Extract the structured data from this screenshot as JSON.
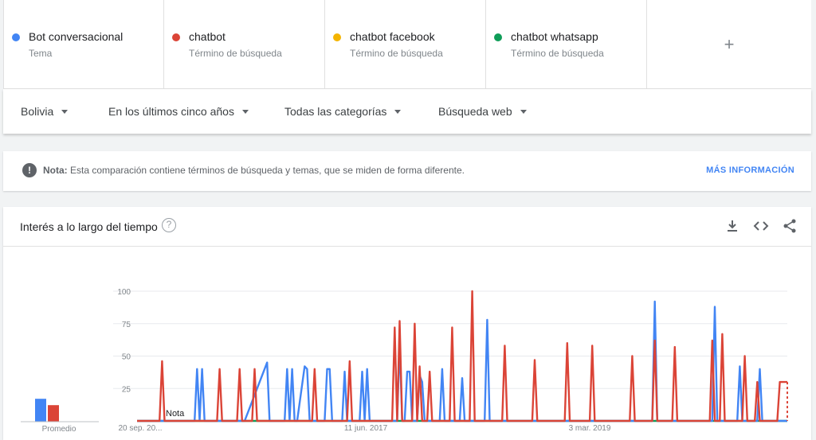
{
  "terms": [
    {
      "name": "Bot conversacional",
      "type": "Tema",
      "color": "#4285f4"
    },
    {
      "name": "chatbot",
      "type": "Término de búsqueda",
      "color": "#db4437"
    },
    {
      "name": "chatbot facebook",
      "type": "Término de búsqueda",
      "color": "#f4b400"
    },
    {
      "name": "chatbot whatsapp",
      "type": "Término de búsqueda",
      "color": "#0f9d58"
    }
  ],
  "add_term_label": "+",
  "filters": {
    "region": "Bolivia",
    "period": "En los últimos cinco años",
    "category": "Todas las categorías",
    "search_type": "Búsqueda web"
  },
  "note": {
    "label": "Nota:",
    "text": " Esta comparación contiene términos de búsqueda y temas, que se miden de forma diferente.",
    "link": "MÁS INFORMACIÓN"
  },
  "card": {
    "title": "Interés a lo largo del tiempo",
    "help": "?",
    "icons": [
      "download-icon",
      "embed-icon",
      "share-icon"
    ]
  },
  "chart_data": {
    "type": "line",
    "yticks": [
      25,
      50,
      75,
      100
    ],
    "ylim": [
      0,
      100
    ],
    "x_labels": [
      "20 sep. 20...",
      "11 jun. 2017",
      "3 mar. 2019"
    ],
    "average_label": "Promedio",
    "annotation": "Nota",
    "averages": [
      {
        "name": "Bot conversacional",
        "value": 18,
        "color": "#4285f4"
      },
      {
        "name": "chatbot",
        "value": 13,
        "color": "#db4437"
      }
    ],
    "series": [
      {
        "name": "chatbot whatsapp",
        "color": "#0f9d58",
        "points": [
          [
            0,
            0
          ],
          [
            260,
            0
          ]
        ]
      },
      {
        "name": "Bot conversacional",
        "color": "#4285f4",
        "points": [
          [
            0,
            0
          ],
          [
            16,
            0
          ],
          [
            17,
            0
          ],
          [
            18,
            0
          ],
          [
            23,
            0
          ],
          [
            24,
            40
          ],
          [
            25,
            0
          ],
          [
            26,
            40
          ],
          [
            27,
            0
          ],
          [
            28,
            0
          ],
          [
            36,
            0
          ],
          [
            37,
            0
          ],
          [
            42,
            0
          ],
          [
            43,
            0
          ],
          [
            52,
            45
          ],
          [
            53,
            0
          ],
          [
            59,
            0
          ],
          [
            60,
            40
          ],
          [
            61,
            0
          ],
          [
            62,
            40
          ],
          [
            63,
            0
          ],
          [
            64,
            0
          ],
          [
            67,
            42
          ],
          [
            68,
            40
          ],
          [
            69,
            0
          ],
          [
            70,
            0
          ],
          [
            71,
            0
          ],
          [
            74,
            0
          ],
          [
            75,
            0
          ],
          [
            76,
            40
          ],
          [
            77,
            40
          ],
          [
            78,
            0
          ],
          [
            82,
            0
          ],
          [
            83,
            38
          ],
          [
            84,
            0
          ],
          [
            85,
            0
          ],
          [
            86,
            0
          ],
          [
            88,
            0
          ],
          [
            89,
            0
          ],
          [
            90,
            38
          ],
          [
            91,
            0
          ],
          [
            92,
            40
          ],
          [
            93,
            0
          ],
          [
            94,
            0
          ],
          [
            95,
            0
          ],
          [
            96,
            0
          ],
          [
            97,
            0
          ],
          [
            98,
            0
          ],
          [
            99,
            0
          ],
          [
            102,
            0
          ],
          [
            103,
            0
          ],
          [
            104,
            0
          ],
          [
            105,
            60
          ],
          [
            106,
            0
          ],
          [
            107,
            0
          ],
          [
            108,
            38
          ],
          [
            109,
            38
          ],
          [
            110,
            0
          ],
          [
            111,
            0
          ],
          [
            112,
            0
          ],
          [
            113,
            35
          ],
          [
            114,
            30
          ],
          [
            115,
            0
          ],
          [
            116,
            0
          ],
          [
            117,
            0
          ],
          [
            118,
            0
          ],
          [
            119,
            0
          ],
          [
            120,
            0
          ],
          [
            121,
            0
          ],
          [
            122,
            40
          ],
          [
            123,
            0
          ],
          [
            124,
            0
          ],
          [
            125,
            0
          ],
          [
            127,
            0
          ],
          [
            128,
            0
          ],
          [
            129,
            0
          ],
          [
            130,
            33
          ],
          [
            131,
            0
          ],
          [
            132,
            0
          ],
          [
            133,
            0
          ],
          [
            134,
            0
          ],
          [
            135,
            0
          ],
          [
            137,
            0
          ],
          [
            138,
            0
          ],
          [
            139,
            0
          ],
          [
            140,
            78
          ],
          [
            141,
            0
          ],
          [
            142,
            0
          ],
          [
            143,
            0
          ],
          [
            144,
            0
          ],
          [
            145,
            0
          ],
          [
            146,
            0
          ],
          [
            147,
            0
          ],
          [
            148,
            0
          ],
          [
            150,
            0
          ],
          [
            151,
            0
          ],
          [
            152,
            0
          ],
          [
            153,
            0
          ],
          [
            154,
            0
          ],
          [
            155,
            0
          ],
          [
            156,
            0
          ],
          [
            157,
            0
          ],
          [
            158,
            0
          ],
          [
            159,
            0
          ],
          [
            160,
            0
          ],
          [
            161,
            0
          ],
          [
            162,
            0
          ],
          [
            163,
            0
          ],
          [
            164,
            0
          ],
          [
            165,
            0
          ],
          [
            166,
            0
          ],
          [
            167,
            0
          ],
          [
            168,
            0
          ],
          [
            169,
            0
          ],
          [
            170,
            0
          ],
          [
            171,
            0
          ],
          [
            172,
            0
          ],
          [
            173,
            0
          ],
          [
            174,
            0
          ],
          [
            175,
            0
          ],
          [
            176,
            0
          ],
          [
            177,
            0
          ],
          [
            178,
            0
          ],
          [
            179,
            0
          ],
          [
            180,
            0
          ],
          [
            181,
            0
          ],
          [
            182,
            0
          ],
          [
            183,
            0
          ],
          [
            184,
            0
          ],
          [
            185,
            0
          ],
          [
            186,
            0
          ],
          [
            187,
            0
          ],
          [
            188,
            0
          ],
          [
            189,
            0
          ],
          [
            190,
            0
          ],
          [
            191,
            0
          ],
          [
            192,
            0
          ],
          [
            193,
            0
          ],
          [
            194,
            0
          ],
          [
            195,
            0
          ],
          [
            196,
            0
          ],
          [
            197,
            0
          ],
          [
            198,
            0
          ],
          [
            199,
            0
          ],
          [
            200,
            0
          ],
          [
            201,
            0
          ],
          [
            202,
            0
          ],
          [
            203,
            0
          ],
          [
            204,
            0
          ],
          [
            205,
            0
          ],
          [
            206,
            0
          ],
          [
            207,
            92
          ],
          [
            208,
            0
          ],
          [
            209,
            0
          ],
          [
            210,
            0
          ],
          [
            211,
            0
          ],
          [
            212,
            0
          ],
          [
            213,
            0
          ],
          [
            214,
            0
          ],
          [
            215,
            0
          ],
          [
            216,
            0
          ],
          [
            217,
            0
          ],
          [
            218,
            0
          ],
          [
            219,
            0
          ],
          [
            220,
            0
          ],
          [
            221,
            0
          ],
          [
            222,
            0
          ],
          [
            223,
            0
          ],
          [
            224,
            0
          ],
          [
            225,
            0
          ],
          [
            226,
            0
          ],
          [
            227,
            0
          ],
          [
            228,
            0
          ],
          [
            229,
            0
          ],
          [
            230,
            0
          ],
          [
            231,
            88
          ],
          [
            232,
            0
          ],
          [
            233,
            0
          ],
          [
            234,
            0
          ],
          [
            235,
            0
          ],
          [
            236,
            0
          ],
          [
            237,
            0
          ],
          [
            238,
            0
          ],
          [
            239,
            0
          ],
          [
            240,
            0
          ],
          [
            241,
            42
          ],
          [
            242,
            0
          ],
          [
            243,
            0
          ],
          [
            244,
            0
          ],
          [
            245,
            0
          ],
          [
            246,
            0
          ],
          [
            247,
            0
          ],
          [
            248,
            0
          ],
          [
            249,
            40
          ],
          [
            250,
            0
          ],
          [
            251,
            0
          ],
          [
            252,
            0
          ],
          [
            253,
            0
          ],
          [
            254,
            0
          ],
          [
            255,
            0
          ],
          [
            256,
            0
          ],
          [
            257,
            0
          ],
          [
            258,
            0
          ],
          [
            259,
            0
          ],
          [
            260,
            0
          ]
        ]
      },
      {
        "name": "chatbot",
        "color": "#db4437",
        "points": [
          [
            0,
            0
          ],
          [
            9,
            0
          ],
          [
            10,
            46
          ],
          [
            11,
            0
          ],
          [
            12,
            0
          ],
          [
            32,
            0
          ],
          [
            33,
            40
          ],
          [
            34,
            0
          ],
          [
            40,
            0
          ],
          [
            41,
            40
          ],
          [
            42,
            0
          ],
          [
            46,
            0
          ],
          [
            47,
            40
          ],
          [
            48,
            0
          ],
          [
            70,
            0
          ],
          [
            71,
            40
          ],
          [
            72,
            0
          ],
          [
            84,
            0
          ],
          [
            85,
            46
          ],
          [
            86,
            0
          ],
          [
            102,
            0
          ],
          [
            103,
            72
          ],
          [
            104,
            0
          ],
          [
            105,
            77
          ],
          [
            106,
            0
          ],
          [
            110,
            0
          ],
          [
            111,
            75
          ],
          [
            112,
            0
          ],
          [
            113,
            42
          ],
          [
            114,
            0
          ],
          [
            116,
            0
          ],
          [
            117,
            38
          ],
          [
            118,
            0
          ],
          [
            125,
            0
          ],
          [
            126,
            72
          ],
          [
            127,
            0
          ],
          [
            133,
            0
          ],
          [
            134,
            100
          ],
          [
            135,
            0
          ],
          [
            146,
            0
          ],
          [
            147,
            58
          ],
          [
            148,
            0
          ],
          [
            158,
            0
          ],
          [
            159,
            47
          ],
          [
            160,
            0
          ],
          [
            171,
            0
          ],
          [
            172,
            60
          ],
          [
            173,
            0
          ],
          [
            181,
            0
          ],
          [
            182,
            58
          ],
          [
            183,
            0
          ],
          [
            197,
            0
          ],
          [
            198,
            50
          ],
          [
            199,
            0
          ],
          [
            206,
            0
          ],
          [
            207,
            62
          ],
          [
            208,
            0
          ],
          [
            214,
            0
          ],
          [
            215,
            57
          ],
          [
            216,
            0
          ],
          [
            229,
            0
          ],
          [
            230,
            62
          ],
          [
            231,
            0
          ],
          [
            233,
            0
          ],
          [
            234,
            67
          ],
          [
            235,
            0
          ],
          [
            242,
            0
          ],
          [
            243,
            50
          ],
          [
            244,
            0
          ],
          [
            247,
            0
          ],
          [
            248,
            30
          ],
          [
            249,
            0
          ],
          [
            256,
            0
          ],
          [
            257,
            30
          ],
          [
            258,
            30
          ],
          [
            259,
            30
          ],
          [
            260,
            30
          ]
        ]
      }
    ]
  }
}
